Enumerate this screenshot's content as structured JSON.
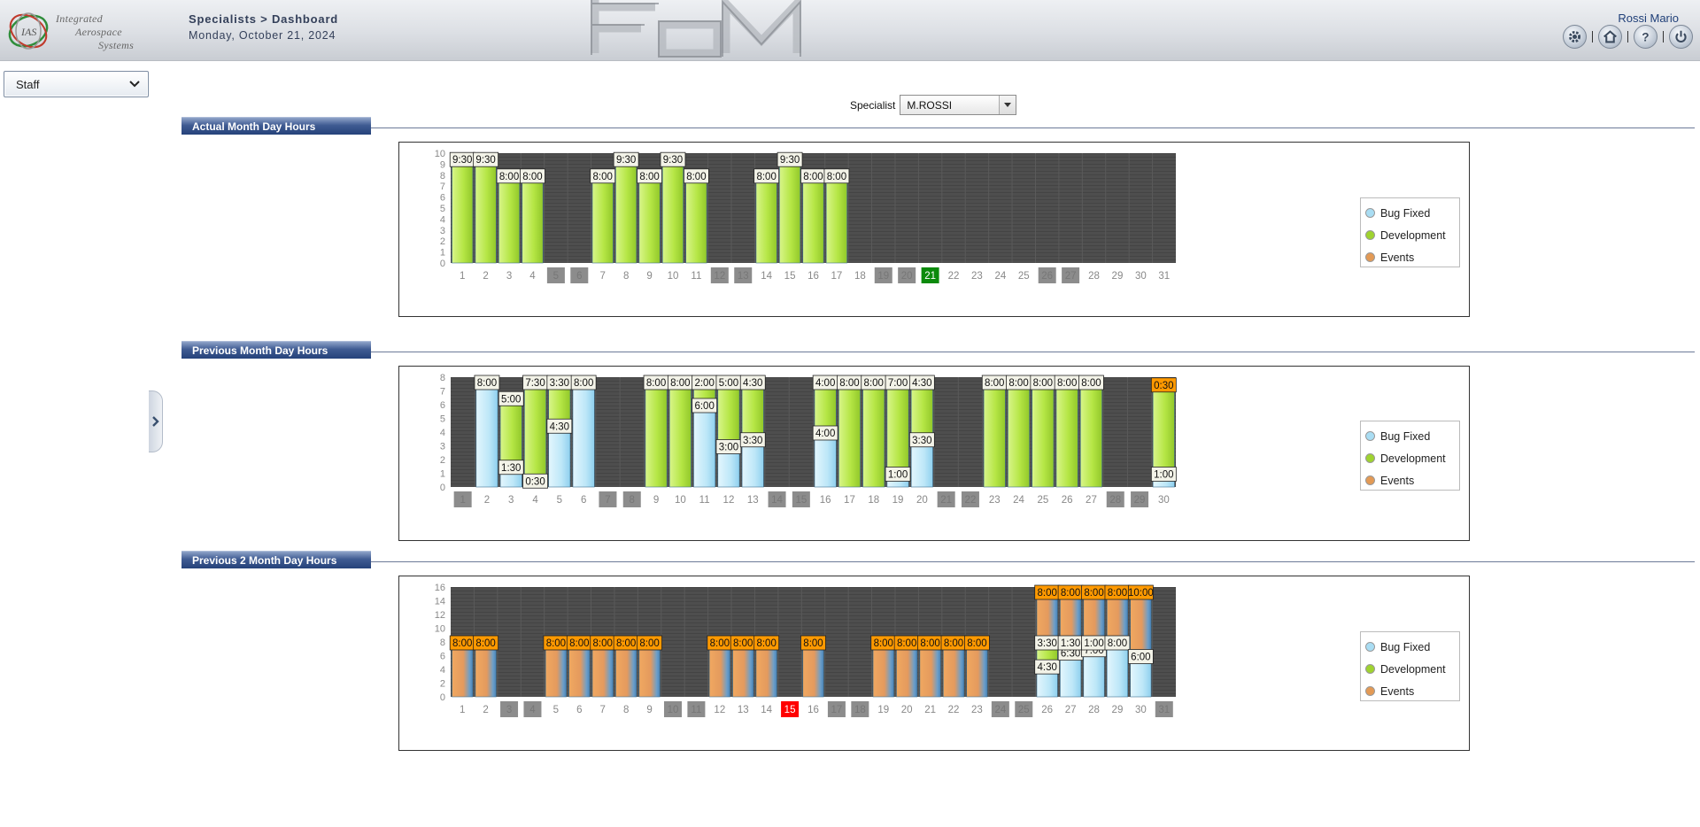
{
  "header": {
    "logo_text": [
      "Integrated",
      "Aerospace",
      "Systems"
    ],
    "logo_mark": "IAS",
    "breadcrumb": "Specialists > Dashboard",
    "date": "Monday, October 21, 2024",
    "user_name": "Rossi Mario",
    "icons": [
      "settings-icon",
      "home-icon",
      "help-icon",
      "power-icon"
    ]
  },
  "sidebar": {
    "staff_select": {
      "value": "Staff"
    }
  },
  "specialist": {
    "label": "Specialist",
    "value": "M.ROSSI"
  },
  "sections": {
    "actual": "Actual Month Day Hours",
    "previous": "Previous Month Day Hours",
    "previous2": "Previous 2 Month Day Hours"
  },
  "legend": [
    {
      "label": "Bug Fixed",
      "color": "#a9ddf3"
    },
    {
      "label": "Development",
      "color": "#9fd32f"
    },
    {
      "label": "Events",
      "color": "#e39a55"
    }
  ],
  "colors": {
    "plot_bg": "#4b4b4b",
    "bug": "#bde7f8",
    "dev": "#b5e645",
    "event": "#eda15c",
    "weekend": "#8c8c8c",
    "today": "#0b8a0b",
    "holiday": "#ff0000",
    "event_label": "#ff9900"
  },
  "chart_data": [
    {
      "type": "bar",
      "title": "Actual Month Day Hours",
      "stacked": true,
      "days": 31,
      "ylim": [
        0,
        10
      ],
      "yticks": [
        0,
        1,
        2,
        3,
        4,
        5,
        6,
        7,
        8,
        9,
        10
      ],
      "weekends": [
        5,
        6,
        12,
        13,
        19,
        20,
        26,
        27
      ],
      "today": 21,
      "holidays": [],
      "bars": [
        {
          "day": 1,
          "segments": [
            {
              "type": "dev",
              "value": 9.5,
              "label": "9:30"
            }
          ]
        },
        {
          "day": 2,
          "segments": [
            {
              "type": "dev",
              "value": 9.5,
              "label": "9:30"
            }
          ]
        },
        {
          "day": 3,
          "segments": [
            {
              "type": "dev",
              "value": 8,
              "label": "8:00"
            }
          ]
        },
        {
          "day": 4,
          "segments": [
            {
              "type": "dev",
              "value": 8,
              "label": "8:00"
            }
          ]
        },
        {
          "day": 7,
          "segments": [
            {
              "type": "dev",
              "value": 8,
              "label": "8:00"
            }
          ]
        },
        {
          "day": 8,
          "segments": [
            {
              "type": "dev",
              "value": 9.5,
              "label": "9:30"
            }
          ]
        },
        {
          "day": 9,
          "segments": [
            {
              "type": "dev",
              "value": 8,
              "label": "8:00"
            }
          ]
        },
        {
          "day": 10,
          "segments": [
            {
              "type": "dev",
              "value": 9.5,
              "label": "9:30"
            }
          ]
        },
        {
          "day": 11,
          "segments": [
            {
              "type": "dev",
              "value": 8,
              "label": "8:00"
            }
          ]
        },
        {
          "day": 14,
          "segments": [
            {
              "type": "dev",
              "value": 8,
              "label": "8:00"
            }
          ]
        },
        {
          "day": 15,
          "segments": [
            {
              "type": "dev",
              "value": 9.5,
              "label": "9:30"
            }
          ]
        },
        {
          "day": 16,
          "segments": [
            {
              "type": "dev",
              "value": 8,
              "label": "8:00"
            }
          ]
        },
        {
          "day": 17,
          "segments": [
            {
              "type": "dev",
              "value": 8,
              "label": "8:00"
            }
          ]
        }
      ]
    },
    {
      "type": "bar",
      "title": "Previous Month Day Hours",
      "stacked": true,
      "days": 30,
      "ylim": [
        0,
        8
      ],
      "yticks": [
        0,
        1,
        2,
        3,
        4,
        5,
        6,
        7,
        8
      ],
      "weekends": [
        1,
        7,
        8,
        14,
        15,
        21,
        22,
        28,
        29
      ],
      "today": null,
      "holidays": [],
      "bars": [
        {
          "day": 2,
          "segments": [
            {
              "type": "bug",
              "value": 8,
              "label": "8:00"
            }
          ]
        },
        {
          "day": 3,
          "segments": [
            {
              "type": "bug",
              "value": 1.5,
              "label": "1:30"
            },
            {
              "type": "dev",
              "value": 5,
              "label": "5:00"
            }
          ]
        },
        {
          "day": 4,
          "segments": [
            {
              "type": "bug",
              "value": 0.5,
              "label": "0:30"
            },
            {
              "type": "dev",
              "value": 7.5,
              "label": "7:30"
            }
          ]
        },
        {
          "day": 5,
          "segments": [
            {
              "type": "bug",
              "value": 4.5,
              "label": "4:30"
            },
            {
              "type": "dev",
              "value": 3.5,
              "label": "3:30"
            }
          ]
        },
        {
          "day": 6,
          "segments": [
            {
              "type": "bug",
              "value": 8,
              "label": "8:00"
            }
          ]
        },
        {
          "day": 9,
          "segments": [
            {
              "type": "dev",
              "value": 8,
              "label": "8:00"
            }
          ]
        },
        {
          "day": 10,
          "segments": [
            {
              "type": "dev",
              "value": 8,
              "label": "8:00"
            }
          ]
        },
        {
          "day": 11,
          "segments": [
            {
              "type": "bug",
              "value": 6,
              "label": "6:00"
            },
            {
              "type": "dev",
              "value": 2,
              "label": "2:00"
            }
          ]
        },
        {
          "day": 12,
          "segments": [
            {
              "type": "bug",
              "value": 3,
              "label": "3:00"
            },
            {
              "type": "dev",
              "value": 5,
              "label": "5:00"
            }
          ]
        },
        {
          "day": 13,
          "segments": [
            {
              "type": "bug",
              "value": 3.5,
              "label": "3:30"
            },
            {
              "type": "dev",
              "value": 4.5,
              "label": "4:30"
            }
          ]
        },
        {
          "day": 16,
          "segments": [
            {
              "type": "bug",
              "value": 4,
              "label": "4:00"
            },
            {
              "type": "dev",
              "value": 4,
              "label": "4:00"
            }
          ]
        },
        {
          "day": 17,
          "segments": [
            {
              "type": "dev",
              "value": 8,
              "label": "8:00"
            }
          ]
        },
        {
          "day": 18,
          "segments": [
            {
              "type": "dev",
              "value": 8,
              "label": "8:00"
            }
          ]
        },
        {
          "day": 19,
          "segments": [
            {
              "type": "bug",
              "value": 1,
              "label": "1:00"
            },
            {
              "type": "dev",
              "value": 7,
              "label": "7:00"
            }
          ]
        },
        {
          "day": 20,
          "segments": [
            {
              "type": "bug",
              "value": 3.5,
              "label": "3:30"
            },
            {
              "type": "dev",
              "value": 4.5,
              "label": "4:30"
            }
          ]
        },
        {
          "day": 23,
          "segments": [
            {
              "type": "dev",
              "value": 8,
              "label": "8:00"
            }
          ]
        },
        {
          "day": 24,
          "segments": [
            {
              "type": "dev",
              "value": 8,
              "label": "8:00"
            }
          ]
        },
        {
          "day": 25,
          "segments": [
            {
              "type": "dev",
              "value": 8,
              "label": "8:00"
            }
          ]
        },
        {
          "day": 26,
          "segments": [
            {
              "type": "dev",
              "value": 8,
              "label": "8:00"
            }
          ]
        },
        {
          "day": 27,
          "segments": [
            {
              "type": "dev",
              "value": 8,
              "label": "8:00"
            }
          ]
        },
        {
          "day": 30,
          "segments": [
            {
              "type": "bug",
              "value": 1,
              "label": "1:00"
            },
            {
              "type": "dev",
              "value": 6,
              "label": ""
            },
            {
              "type": "event",
              "value": 0.5,
              "label": "0:30"
            }
          ]
        }
      ]
    },
    {
      "type": "bar",
      "title": "Previous 2 Month Day Hours",
      "stacked": true,
      "days": 31,
      "ylim": [
        0,
        16
      ],
      "yticks": [
        0,
        2,
        4,
        6,
        8,
        10,
        12,
        14,
        16
      ],
      "weekends": [
        3,
        4,
        10,
        11,
        17,
        18,
        24,
        25,
        31
      ],
      "today": null,
      "holidays": [
        15
      ],
      "bars": [
        {
          "day": 1,
          "segments": [
            {
              "type": "event",
              "value": 8,
              "label": "8:00"
            }
          ]
        },
        {
          "day": 2,
          "segments": [
            {
              "type": "event",
              "value": 8,
              "label": "8:00"
            }
          ]
        },
        {
          "day": 5,
          "segments": [
            {
              "type": "event",
              "value": 8,
              "label": "8:00"
            }
          ]
        },
        {
          "day": 6,
          "segments": [
            {
              "type": "event",
              "value": 8,
              "label": "8:00"
            }
          ]
        },
        {
          "day": 7,
          "segments": [
            {
              "type": "event",
              "value": 8,
              "label": "8:00"
            }
          ]
        },
        {
          "day": 8,
          "segments": [
            {
              "type": "event",
              "value": 8,
              "label": "8:00"
            }
          ]
        },
        {
          "day": 9,
          "segments": [
            {
              "type": "event",
              "value": 8,
              "label": "8:00"
            }
          ]
        },
        {
          "day": 12,
          "segments": [
            {
              "type": "event",
              "value": 8,
              "label": "8:00"
            }
          ]
        },
        {
          "day": 13,
          "segments": [
            {
              "type": "event",
              "value": 8,
              "label": "8:00"
            }
          ]
        },
        {
          "day": 14,
          "segments": [
            {
              "type": "event",
              "value": 8,
              "label": "8:00"
            }
          ]
        },
        {
          "day": 16,
          "segments": [
            {
              "type": "event",
              "value": 8,
              "label": "8:00"
            }
          ]
        },
        {
          "day": 19,
          "segments": [
            {
              "type": "event",
              "value": 8,
              "label": "8:00"
            }
          ]
        },
        {
          "day": 20,
          "segments": [
            {
              "type": "event",
              "value": 8,
              "label": "8:00"
            }
          ]
        },
        {
          "day": 21,
          "segments": [
            {
              "type": "event",
              "value": 8,
              "label": "8:00"
            }
          ]
        },
        {
          "day": 22,
          "segments": [
            {
              "type": "event",
              "value": 8,
              "label": "8:00"
            }
          ]
        },
        {
          "day": 23,
          "segments": [
            {
              "type": "event",
              "value": 8,
              "label": "8:00"
            }
          ]
        },
        {
          "day": 26,
          "segments": [
            {
              "type": "bug",
              "value": 4.5,
              "label": "4:30"
            },
            {
              "type": "dev",
              "value": 3.5,
              "label": "3:30"
            },
            {
              "type": "event",
              "value": 8,
              "label": "8:00"
            }
          ]
        },
        {
          "day": 27,
          "segments": [
            {
              "type": "bug",
              "value": 6.5,
              "label": "6:30"
            },
            {
              "type": "dev",
              "value": 1.5,
              "label": "1:30"
            },
            {
              "type": "event",
              "value": 8,
              "label": "8:00"
            }
          ]
        },
        {
          "day": 28,
          "segments": [
            {
              "type": "bug",
              "value": 7,
              "label": "7:00"
            },
            {
              "type": "dev",
              "value": 1,
              "label": "1:00"
            },
            {
              "type": "event",
              "value": 8,
              "label": "8:00"
            }
          ]
        },
        {
          "day": 29,
          "segments": [
            {
              "type": "bug",
              "value": 8,
              "label": "8:00"
            },
            {
              "type": "event",
              "value": 8,
              "label": "8:00"
            }
          ]
        },
        {
          "day": 30,
          "segments": [
            {
              "type": "bug",
              "value": 6,
              "label": "6:00"
            },
            {
              "type": "event",
              "value": 10,
              "label": "10:00"
            }
          ]
        }
      ]
    }
  ]
}
